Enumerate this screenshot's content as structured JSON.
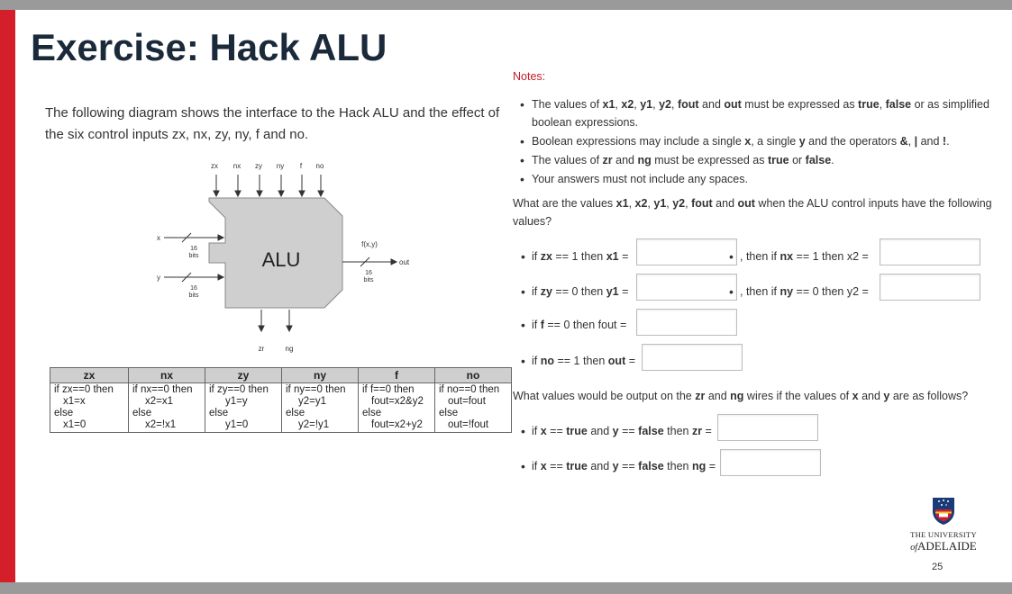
{
  "slide": {
    "title": "Exercise: Hack ALU",
    "intro": "The following diagram shows the interface to the Hack ALU and the effect of the six control inputs zx, nx, zy, ny, f and no.",
    "page_number": "25"
  },
  "diagram": {
    "control_inputs": [
      "zx",
      "nx",
      "zy",
      "ny",
      "f",
      "no"
    ],
    "chip_label": "ALU",
    "input_x": "x",
    "input_y": "y",
    "bus_width": "16",
    "bus_unit": "bits",
    "output_func": "f(x,y)",
    "output_label": "out",
    "flags": [
      "zr",
      "ng"
    ]
  },
  "control_table": {
    "headers": [
      "zx",
      "nx",
      "zy",
      "ny",
      "f",
      "no"
    ],
    "cells": [
      [
        "if zx==0 then",
        "x1=x",
        "else",
        "x1=0"
      ],
      [
        "if nx==0 then",
        "x2=x1",
        "else",
        "x2=!x1"
      ],
      [
        "if zy==0 then",
        "y1=y",
        "else",
        "y1=0"
      ],
      [
        "if ny==0 then",
        "y2=y1",
        "else",
        "y2=!y1"
      ],
      [
        "if f==0 then",
        "fout=x2&y2",
        "else",
        "fout=x2+y2"
      ],
      [
        "if no==0 then",
        "out=fout",
        "else",
        "out=!fout"
      ]
    ]
  },
  "notes": {
    "heading": "Notes:",
    "items": [
      [
        "The values of ",
        "x1",
        ", ",
        "x2",
        ", ",
        "y1",
        ", ",
        "y2",
        ", ",
        "fout",
        " and ",
        "out",
        " must be expressed as ",
        "true",
        ", ",
        "false",
        " or as simplified boolean expressions."
      ],
      [
        "Boolean expressions may include a single ",
        "x",
        ", a single ",
        "y",
        " and the operators ",
        "&",
        ", ",
        "|",
        " and ",
        "!",
        "."
      ],
      [
        "The values of ",
        "zr",
        " and ",
        "ng",
        " must be expressed as ",
        "true",
        " or ",
        "false",
        "."
      ],
      [
        "Your answers must not include any spaces."
      ]
    ]
  },
  "question1": [
    "What are the values ",
    "x1",
    ", ",
    "x2",
    ", ",
    "y1",
    ", ",
    "y2",
    ", ",
    "fout",
    " and ",
    "out",
    " when the ALU control inputs have the following values?"
  ],
  "question2": [
    "What values would be output on the ",
    "zr",
    " and ",
    "ng",
    " wires if the values of ",
    "x",
    " and ",
    "y",
    " are as follows?"
  ],
  "answers": {
    "zx_prompt": [
      "if ",
      "zx",
      " == 1 then ",
      "x1",
      " ="
    ],
    "nx_prompt": [
      ", then if ",
      "nx",
      " == 1 then x2 ="
    ],
    "zy_prompt": [
      "if ",
      "zy",
      " == 0 then ",
      "y1",
      " ="
    ],
    "ny_prompt": [
      ", then if ",
      "ny",
      " == 0 then y2 ="
    ],
    "f_prompt": [
      "if ",
      "f",
      " == 0 then fout ="
    ],
    "no_prompt": [
      "if ",
      "no",
      " == 1 then ",
      "out",
      " ="
    ],
    "zr_prompt": [
      "if ",
      "x",
      " == ",
      "true",
      " and ",
      "y",
      " == ",
      "false",
      " then ",
      "zr",
      " ="
    ],
    "ng_prompt": [
      "if ",
      "x",
      " == ",
      "true",
      " and ",
      "y",
      " == ",
      "false",
      " then ",
      "ng",
      " ="
    ],
    "x1_value": "",
    "x2_value": "",
    "y1_value": "",
    "y2_value": "",
    "fout_value": "",
    "out_value": "",
    "zr_value": "",
    "ng_value": ""
  },
  "logo": {
    "line1": "THE UNIVERSITY",
    "line2_prefix": "of",
    "line2": "ADELAIDE"
  },
  "colors": {
    "accent_red": "#d41f2a",
    "title_navy": "#1b2a3a",
    "notes_heading": "#c01d2a",
    "chip_fill": "#cfcfcf"
  }
}
